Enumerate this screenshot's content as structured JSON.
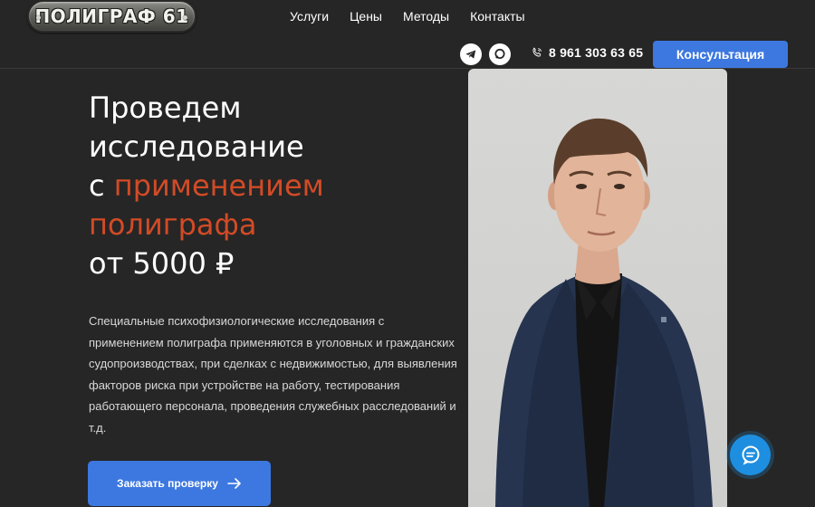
{
  "header": {
    "logo_text": "ПОЛИГРАФ 61",
    "nav": [
      "Услуги",
      "Цены",
      "Методы",
      "Контакты"
    ],
    "social_icons": [
      "telegram-icon",
      "chat-icon"
    ],
    "phone": "8 961 303 63 65",
    "cta_label": "Консультация"
  },
  "hero": {
    "title_line1": "Проведем",
    "title_line2": "исследование",
    "title_line3_prefix": "с ",
    "title_line3_accent": "применением",
    "title_line4_accent": "полиграфа",
    "title_line5": "от 5000 ₽",
    "description": "Специальные психофизиологические исследования с применением полиграфа применяются в уголовных и гражданских судопроизводствах, при сделках с недвижимостью, для выявления факторов риска при устройстве на работу, тестирования работающего персонала, проведения служебных расследований и т.д.",
    "button_label": "Заказать проверку"
  },
  "colors": {
    "background": "#262626",
    "accent": "#d24b26",
    "button": "#3d78e0",
    "chat": "#1e8fe0"
  }
}
